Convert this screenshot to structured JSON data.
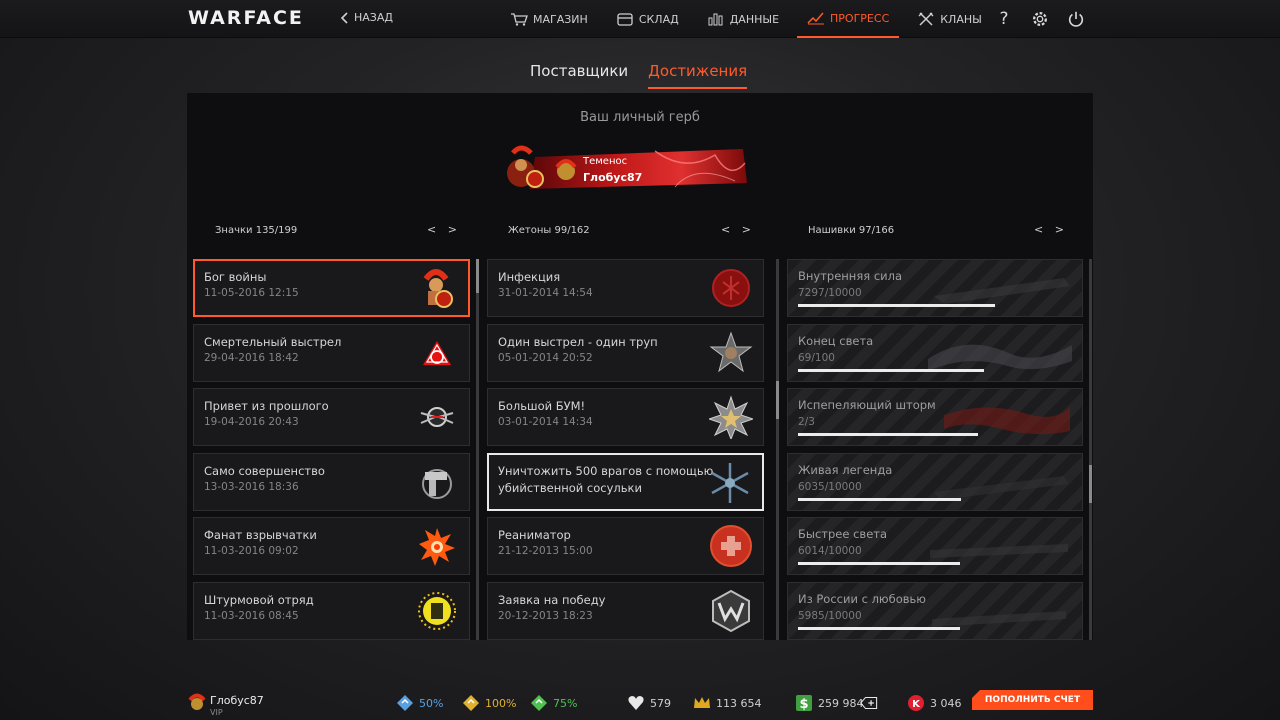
{
  "topbar": {
    "logo": "WARFACE",
    "back_label": "НАЗАД",
    "nav": [
      {
        "label": "МАГАЗИН",
        "icon": "cart-icon",
        "active": false
      },
      {
        "label": "СКЛАД",
        "icon": "storage-icon",
        "active": false
      },
      {
        "label": "ДАННЫЕ",
        "icon": "stats-icon",
        "active": false
      },
      {
        "label": "ПРОГРЕСС",
        "icon": "progress-icon",
        "active": true
      },
      {
        "label": "КЛАНЫ",
        "icon": "clans-icon",
        "active": false
      }
    ],
    "help_symbol": "?"
  },
  "subtabs": [
    {
      "label": "Поставщики",
      "active": false
    },
    {
      "label": "Достижения",
      "active": true
    }
  ],
  "emblem": {
    "title": "Ваш личный герб",
    "label1": "Теменос",
    "label2": "Глобус87"
  },
  "columns": {
    "badges": {
      "title": "Значки 135/199",
      "arrows": "< >"
    },
    "tokens": {
      "title": "Жетоны 99/162",
      "arrows": "< >"
    },
    "stripes": {
      "title": "Нашивки 97/166",
      "arrows": "< >"
    }
  },
  "badges": [
    {
      "name": "Бог войны",
      "date": "11-05-2016 12:15",
      "icon": "spartan-icon"
    },
    {
      "name": "Смертельный выстрел",
      "date": "29-04-2016 18:42",
      "icon": "triangle-target-icon"
    },
    {
      "name": "Привет из прошлого",
      "date": "19-04-2016 20:43",
      "icon": "wing-emblem-icon"
    },
    {
      "name": "Само совершенство",
      "date": "13-03-2016 18:36",
      "icon": "pistol-icon"
    },
    {
      "name": "Фанат взрывчатки",
      "date": "11-03-2016 09:02",
      "icon": "explosion-icon"
    },
    {
      "name": "Штурмовой отряд",
      "date": "11-03-2016 08:45",
      "icon": "assault-icon"
    }
  ],
  "tokens": [
    {
      "name": "Инфекция",
      "date": "31-01-2014 14:54",
      "icon": "infection-icon"
    },
    {
      "name": "Один выстрел - один труп",
      "date": "05-01-2014 20:52",
      "icon": "skull-star-icon"
    },
    {
      "name": "Большой БУМ!",
      "date": "03-01-2014 14:34",
      "icon": "star-medal-icon"
    },
    {
      "name": "Уничтожить 500 врагов с помощью убийственной сосульки",
      "date": "",
      "icon": "snowflake-icon"
    },
    {
      "name": "Реаниматор",
      "date": "21-12-2013 15:00",
      "icon": "medic-cross-icon"
    },
    {
      "name": "Заявка на победу",
      "date": "20-12-2013 18:23",
      "icon": "w-medal-icon"
    }
  ],
  "stripes": [
    {
      "name": "Внутренняя сила",
      "progress": "7297/10000",
      "fraction": 0.7297
    },
    {
      "name": "Конец света",
      "progress": "69/100",
      "fraction": 0.69
    },
    {
      "name": "Испепеляющий шторм",
      "progress": "2/3",
      "fraction": 0.6667
    },
    {
      "name": "Живая легенда",
      "progress": "6035/10000",
      "fraction": 0.6035
    },
    {
      "name": "Быстрее света",
      "progress": "6014/10000",
      "fraction": 0.6014
    },
    {
      "name": "Из России с любовью",
      "progress": "5985/10000",
      "fraction": 0.5985
    }
  ],
  "bottom": {
    "player_name": "Глобус87",
    "vip": "VIP",
    "boosts": [
      {
        "value": "50%",
        "color": "#5aa0e0",
        "icon": "exp-boost-icon"
      },
      {
        "value": "100%",
        "color": "#e0b030",
        "icon": "money-boost-icon"
      },
      {
        "value": "75%",
        "color": "#50c050",
        "icon": "vp-boost-icon"
      }
    ],
    "rank_points": "579",
    "crowns": "113 654",
    "money": "259 984",
    "kredits": "3 046",
    "topup_label": "ПОПОЛНИТЬ СЧЕТ",
    "accent": "#ff5a2a"
  }
}
